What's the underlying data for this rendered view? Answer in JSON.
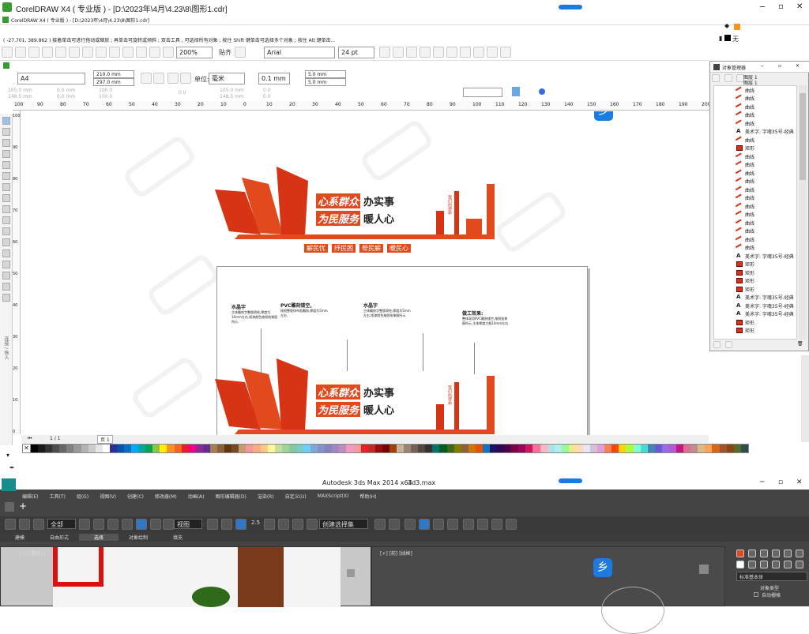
{
  "cdr": {
    "title": "CorelDRAW X4 ( 专业版 ) - [D:\\2023年\\4月\\4.23\\8\\图形1.cdr]",
    "subtitle": "CorelDRAW X4 ( 专业版 ) - [D:\\2023年\\4月\\4.23\\8\\图形1.cdr]",
    "status": "( -27.701, 389.862 )    接着单击可进行拖动或缩放 ; 再单击可旋转或倾斜 ; 双击工具 , 可选择所有对象 ; 按住 Shift 键单击可选择多个对象 ; 按住 Alt 键单击...",
    "fill_none": "无",
    "zoom": "200%",
    "paste_label": "贴齐",
    "font_name": "Arial",
    "font_size": "24 pt",
    "page_size": "A4",
    "width": "210.0 mm",
    "height": "297.0 mm",
    "unit_label": "单位:",
    "unit": "毫米",
    "nudge": "0.1 mm",
    "dup_x": "5.0 mm",
    "dup_y": "5.0 mm",
    "x": "105.0 mm",
    "y": "148.5 mm",
    "w": "0.0 mm",
    "h": "0.0 mm",
    "pct1": "100.0",
    "pct2": "100.0",
    "angle": "0.0",
    "p1": "105.0 mm",
    "p2": "148.5 mm",
    "dot1": "0.0",
    "dot2": "0.0",
    "ruler": [
      "100",
      "90",
      "80",
      "70",
      "60",
      "50",
      "40",
      "30",
      "20",
      "10",
      "0",
      "10",
      "20",
      "30",
      "40",
      "50",
      "60",
      "70",
      "80",
      "90",
      "100",
      "110",
      "120",
      "130",
      "140",
      "150",
      "160",
      "170",
      "180",
      "190",
      "200"
    ],
    "vruler": [
      "100",
      "90",
      "80",
      "70",
      "60",
      "50",
      "40",
      "30",
      "20",
      "10",
      "0"
    ],
    "page_nav": "1 / 1",
    "page_tab": "页 1",
    "side_label": "连接 / 拖入",
    "logo_letter": "乡",
    "sign": {
      "line1a": "心系群众",
      "line1b": "办实事",
      "line2a": "为民服务",
      "line2b": "暖人心",
      "sub": [
        "解民忧",
        "纾民困",
        "帮民解",
        "暖民心"
      ],
      "seal": "我们的使命"
    },
    "notes": [
      {
        "title": "水晶字",
        "text": "主体雕刻字整版喷绘,厚度为10mm左右,喷漆颜色按照效果图所示."
      },
      {
        "title": "PVC雕刻镂空,",
        "text": "按照整版排布贴雕刻,厚度为5mm左右."
      },
      {
        "title": "水晶字",
        "text": "主体雕刻字整版喷绘,厚度为5mm左右,喷漆颜色按照效果图所示."
      },
      {
        "title": "做工效果:",
        "text": "整体采用PVC雕刻镂空,按照效果图所示,主体厚度大概10mm左右."
      }
    ]
  },
  "objmgr": {
    "title": "对象管理器",
    "layers": [
      "图层 1",
      "图层 1"
    ],
    "items": [
      {
        "label": "曲线",
        "icon": "curve"
      },
      {
        "label": "曲线",
        "icon": "curve"
      },
      {
        "label": "曲线",
        "icon": "curve"
      },
      {
        "label": "曲线",
        "icon": "curve"
      },
      {
        "label": "曲线",
        "icon": "curve"
      },
      {
        "label": "美术字: 字魂35号-经典",
        "icon": "text"
      },
      {
        "label": "曲线",
        "icon": "curve"
      },
      {
        "label": "矩形",
        "icon": "rect"
      },
      {
        "label": "曲线",
        "icon": "curve"
      },
      {
        "label": "曲线",
        "icon": "curve"
      },
      {
        "label": "曲线",
        "icon": "curve"
      },
      {
        "label": "曲线",
        "icon": "curve"
      },
      {
        "label": "曲线",
        "icon": "curve"
      },
      {
        "label": "曲线",
        "icon": "curve"
      },
      {
        "label": "曲线",
        "icon": "curve"
      },
      {
        "label": "曲线",
        "icon": "curve"
      },
      {
        "label": "曲线",
        "icon": "curve"
      },
      {
        "label": "曲线",
        "icon": "curve"
      },
      {
        "label": "曲线",
        "icon": "curve"
      },
      {
        "label": "曲线",
        "icon": "curve"
      },
      {
        "label": "美术字: 字魂35号-经典",
        "icon": "text"
      },
      {
        "label": "矩形",
        "icon": "rect"
      },
      {
        "label": "矩形",
        "icon": "rect"
      },
      {
        "label": "矩形",
        "icon": "rect"
      },
      {
        "label": "矩形",
        "icon": "rect"
      },
      {
        "label": "美术字: 字魂35号-经典",
        "icon": "text"
      },
      {
        "label": "美术字: 字魂35号-经典",
        "icon": "text"
      },
      {
        "label": "美术字: 字魂35号-经典",
        "icon": "text"
      },
      {
        "label": "矩形",
        "icon": "rect"
      },
      {
        "label": "矩形",
        "icon": "rect"
      }
    ]
  },
  "max": {
    "title": "Autodesk 3ds Max  2014 x64",
    "file": "3d3.max",
    "menu": [
      "编辑(E)",
      "工具(T)",
      "组(G)",
      "视图(V)",
      "创建(C)",
      "修改器(M)",
      "动画(A)",
      "图形编辑器(D)",
      "渲染(R)",
      "自定义(U)",
      "MAXScript(X)",
      "帮助(H)"
    ],
    "filter": "全部",
    "refsys": "视图",
    "snap_pct": "2.5",
    "selset": "创建选择集",
    "ribbon_tabs": [
      "建模",
      "自由形式",
      "选择",
      "对象绘制",
      "填充"
    ],
    "vp_left": "[+] [透视] [",
    "vp_right": "[+] [前] [线框]",
    "cmd_dropdown": "标准基本体",
    "cmd_section": "对象类型",
    "cmd_autogrid": "自动栅格"
  },
  "colors": {
    "accent": "#e2491d",
    "red": "#d63414",
    "blue": "#1b7be0",
    "panel": "#f0f0f0",
    "dark": "#2b2b2b"
  },
  "palette": [
    "#000000",
    "#1a1a1a",
    "#333333",
    "#4d4d4d",
    "#666666",
    "#808080",
    "#999999",
    "#b3b3b3",
    "#cccccc",
    "#e6e6e6",
    "#ffffff",
    "#2e3192",
    "#0054a6",
    "#0072bc",
    "#00aeef",
    "#00a99d",
    "#00a651",
    "#8dc63f",
    "#fff200",
    "#f7941d",
    "#f26522",
    "#ed1c24",
    "#ec008c",
    "#92278f",
    "#662d91",
    "#a67c52",
    "#8b5e3c",
    "#603913",
    "#754c24",
    "#c69c6d",
    "#f5989d",
    "#f9ad81",
    "#fdc68a",
    "#fff799",
    "#c4df9b",
    "#a3d39c",
    "#82ca9c",
    "#7accc8",
    "#6dcff6",
    "#7da7d9",
    "#8393ca",
    "#8781bd",
    "#a186be",
    "#bd8cbf",
    "#f49ac2",
    "#f6989d",
    "#ee1d23",
    "#c1272d",
    "#9e0b0f",
    "#790000",
    "#a0410d",
    "#c7b299",
    "#998675",
    "#736357",
    "#534741",
    "#362f2d",
    "#00746b",
    "#005e20",
    "#406618",
    "#827b00",
    "#8c6239",
    "#c77c00",
    "#e35205",
    "#0f75bc",
    "#1b1464",
    "#2e0854",
    "#4b0049",
    "#7b0046",
    "#9e005d",
    "#d4145a",
    "#ff6f9c",
    "#ffb6c1",
    "#b0e0e6",
    "#afeeee",
    "#98fb98",
    "#f0e68c",
    "#ffdab9",
    "#e6e6fa",
    "#d8bfd8",
    "#dda0dd",
    "#ff7f50",
    "#ff4500",
    "#ffd700",
    "#adff2f",
    "#7fffd4",
    "#40e0d0",
    "#4682b4",
    "#6a5acd",
    "#9370db",
    "#ba55d3",
    "#c71585",
    "#db7093",
    "#bc8f8f",
    "#deb887",
    "#f4a460",
    "#d2691e",
    "#a0522d",
    "#8b4513",
    "#556b2f",
    "#2f4f4f"
  ],
  "icons": [
    "pick-icon",
    "shape-icon",
    "crop-icon",
    "zoom-icon",
    "freehand-icon",
    "smart-fill-icon",
    "rectangle-icon",
    "ellipse-icon",
    "polygon-icon",
    "basic-shapes-icon",
    "text-icon",
    "table-icon",
    "blend-icon",
    "eyedropper-icon",
    "outline-icon",
    "fill-icon",
    "interactive-fill-icon"
  ]
}
